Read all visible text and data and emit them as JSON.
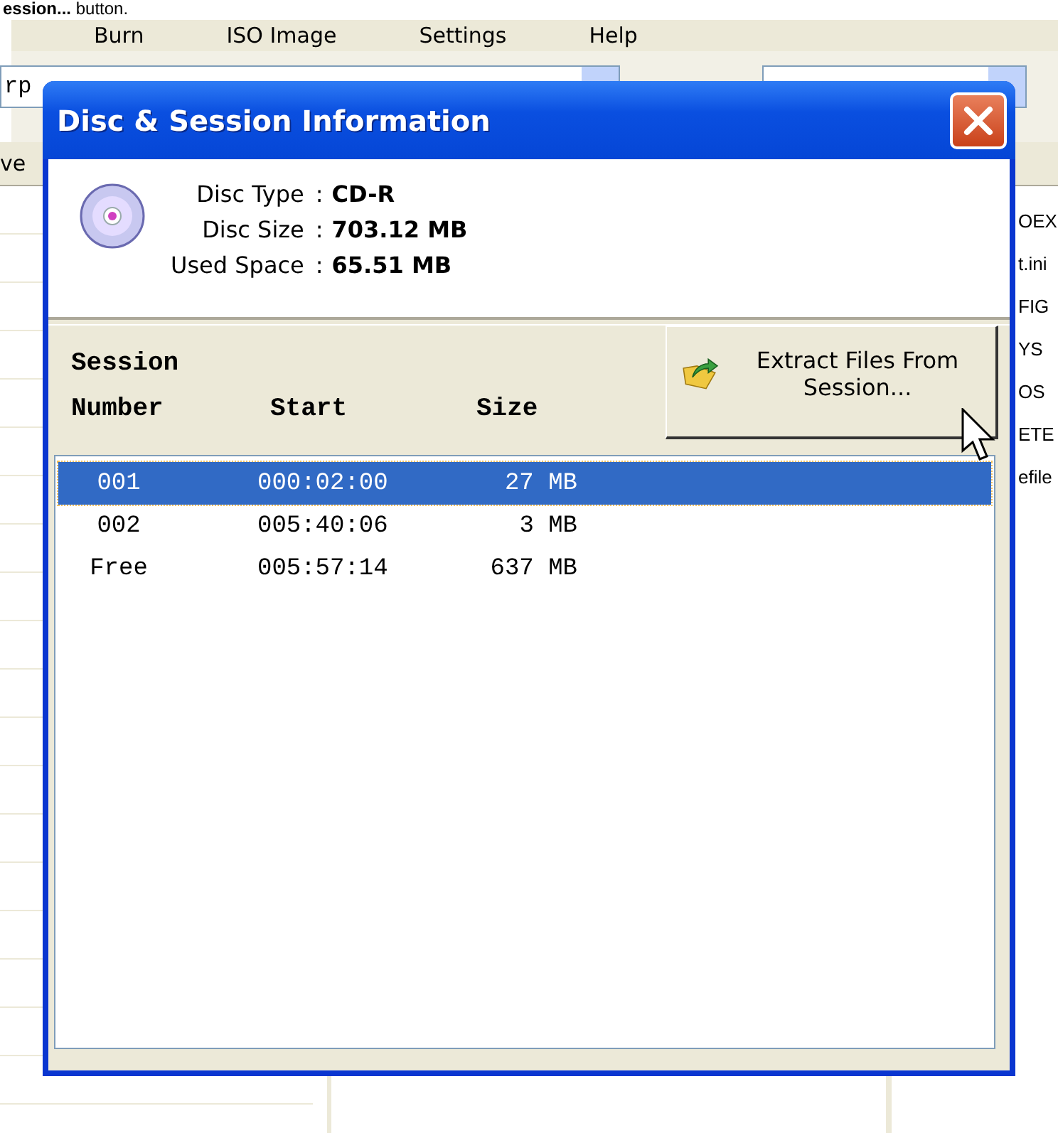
{
  "caption": "**ession...** button.",
  "menu": [
    {
      "label": "Burn"
    },
    {
      "label": "ISO Image"
    },
    {
      "label": "Settings"
    },
    {
      "label": "Help"
    }
  ],
  "path_field": {
    "value": "rp"
  },
  "side_tab": "ve",
  "file_list": [
    "OEX",
    "t.ini",
    "FIG",
    "YS",
    "OS",
    "ETE",
    "efile"
  ],
  "dialog": {
    "title": "Disc & Session Information",
    "disc_info": [
      {
        "label": "Disc Type",
        "separator": ":",
        "value": "CD-R"
      },
      {
        "label": "Disc Size",
        "separator": ":",
        "value": "703.12 MB"
      },
      {
        "label": "Used Space",
        "separator": ":",
        "value": "65.51 MB"
      }
    ],
    "columns": [
      "Session Number",
      "Start",
      "Size"
    ],
    "extract_button": "Extract Files From Session...",
    "sessions": [
      {
        "number": "001",
        "start": "000:02:00",
        "size": "27 MB",
        "selected": true
      },
      {
        "number": "002",
        "start": "005:40:06",
        "size": "3 MB",
        "selected": false
      },
      {
        "number": "Free",
        "start": "005:57:14",
        "size": "637 MB",
        "selected": false
      }
    ]
  }
}
